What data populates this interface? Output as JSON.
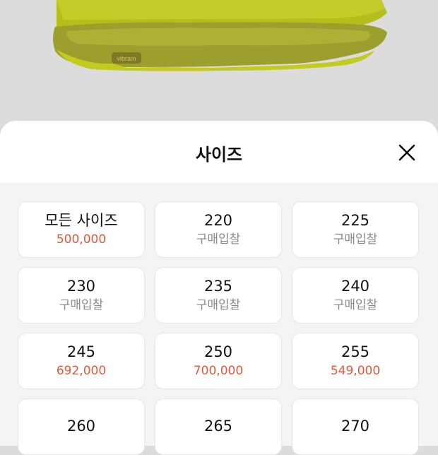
{
  "product": {
    "brand_mark": "vibram"
  },
  "sheet": {
    "title": "사이즈"
  },
  "colors": {
    "price": "#e05a3f",
    "muted": "#8a8a8a",
    "shoe": "#b8c21f"
  },
  "sizes": [
    {
      "size": "모든 사이즈",
      "status": "500,000",
      "type": "price"
    },
    {
      "size": "220",
      "status": "구매입찰",
      "type": "bid"
    },
    {
      "size": "225",
      "status": "구매입찰",
      "type": "bid"
    },
    {
      "size": "230",
      "status": "구매입찰",
      "type": "bid"
    },
    {
      "size": "235",
      "status": "구매입찰",
      "type": "bid"
    },
    {
      "size": "240",
      "status": "구매입찰",
      "type": "bid"
    },
    {
      "size": "245",
      "status": "692,000",
      "type": "price"
    },
    {
      "size": "250",
      "status": "700,000",
      "type": "price"
    },
    {
      "size": "255",
      "status": "549,000",
      "type": "price"
    },
    {
      "size": "260",
      "status": "",
      "type": "price"
    },
    {
      "size": "265",
      "status": "",
      "type": "price"
    },
    {
      "size": "270",
      "status": "",
      "type": "price"
    }
  ]
}
